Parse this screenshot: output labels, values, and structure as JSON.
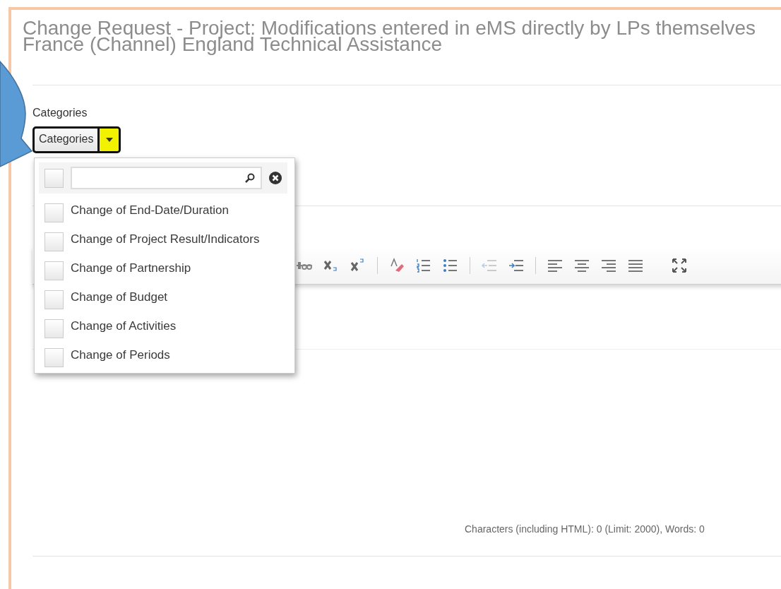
{
  "title_lines": [
    "Change Request - Project: Modifications entered in eMS directly by LPs themselves",
    "France (Channel) England Technical Assistance"
  ],
  "categories": {
    "label": "Categories",
    "button_text": "Categories",
    "expanded": true,
    "popup": {
      "select_all_checked": false,
      "options": [
        {
          "label": "Change of End-Date/Duration",
          "checked": false
        },
        {
          "label": "Change of Project Result/Indicators",
          "checked": false
        },
        {
          "label": "Change of Partnership",
          "checked": false
        },
        {
          "label": "Change of Budget",
          "checked": false
        },
        {
          "label": "Change of Activities",
          "checked": false
        },
        {
          "label": "Change of Periods",
          "checked": false
        }
      ]
    }
  },
  "editor": {
    "counter": "Characters (including HTML): 0 (Limit: 2000), Words: 0"
  }
}
